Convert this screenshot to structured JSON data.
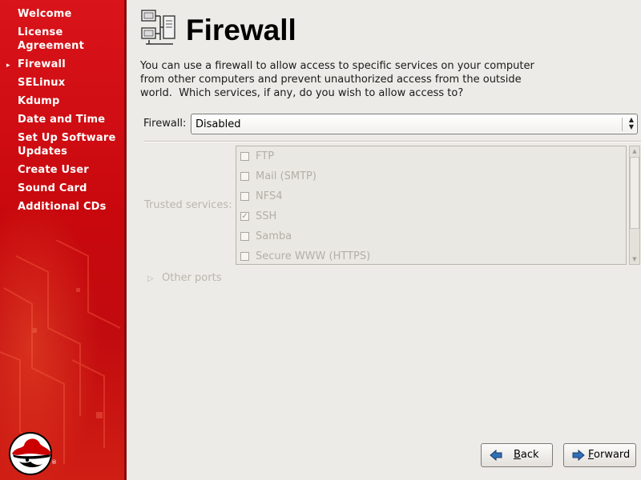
{
  "sidebar": {
    "steps": [
      {
        "label": "Welcome",
        "current": false
      },
      {
        "label": "License\nAgreement",
        "current": false
      },
      {
        "label": "Firewall",
        "current": true
      },
      {
        "label": "SELinux",
        "current": false
      },
      {
        "label": "Kdump",
        "current": false
      },
      {
        "label": "Date and Time",
        "current": false
      },
      {
        "label": "Set Up Software\nUpdates",
        "current": false
      },
      {
        "label": "Create User",
        "current": false
      },
      {
        "label": "Sound Card",
        "current": false
      },
      {
        "label": "Additional CDs",
        "current": false
      }
    ],
    "current_marker": "▸",
    "logo_icon": "redhat-shadowman-logo",
    "logo_mark": "®"
  },
  "header": {
    "title": "Firewall",
    "icon": "firewall-network-icon"
  },
  "description": [
    "You can use a firewall to allow access to specific services on your computer",
    "from other computers and prevent unauthorized access from the outside",
    "world.  Which services, if any, do you wish to allow access to?"
  ],
  "firewall": {
    "label": "Firewall:",
    "value": "Disabled",
    "arrow_up": "▲",
    "arrow_down": "▼"
  },
  "trusted_services": {
    "label": "Trusted services:",
    "items": [
      {
        "label": "FTP",
        "checked": false
      },
      {
        "label": "Mail (SMTP)",
        "checked": false
      },
      {
        "label": "NFS4",
        "checked": false
      },
      {
        "label": "SSH",
        "checked": true
      },
      {
        "label": "Samba",
        "checked": false
      },
      {
        "label": "Secure WWW (HTTPS)",
        "checked": false
      }
    ],
    "scroll_up": "▲",
    "scroll_down": "▼"
  },
  "other_ports": {
    "label": "Other ports",
    "expander": "▷"
  },
  "buttons": {
    "back": {
      "pre": "",
      "mnemonic": "B",
      "post": "ack"
    },
    "forward": {
      "pre": "",
      "mnemonic": "F",
      "post": "orward"
    }
  },
  "colors": {
    "sidebar_red": "#c8080d",
    "background": "#edebe7",
    "disabled_text": "#b2afa7",
    "button_arrow_blue": "#2f6fb5"
  }
}
